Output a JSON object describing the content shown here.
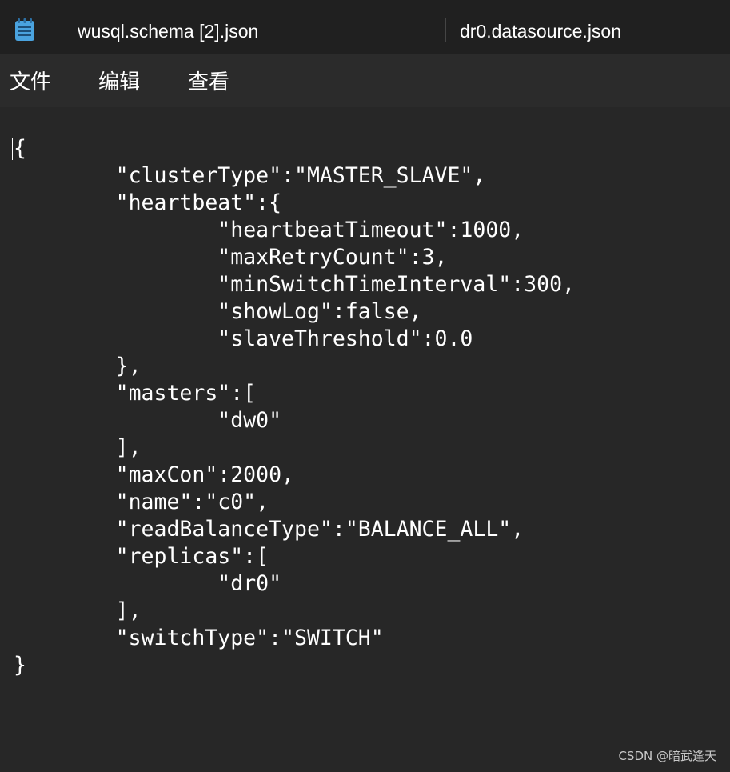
{
  "app": {
    "icon": "notepad-icon"
  },
  "tabs": [
    {
      "label": "wusql.schema [2].json"
    },
    {
      "label": "dr0.datasource.json"
    }
  ],
  "menu": {
    "file": "文件",
    "edit": "编辑",
    "view": "查看"
  },
  "editor": {
    "lines": [
      "{",
      "\t\"clusterType\":\"MASTER_SLAVE\",",
      "\t\"heartbeat\":{",
      "\t\t\"heartbeatTimeout\":1000,",
      "\t\t\"maxRetryCount\":3,",
      "\t\t\"minSwitchTimeInterval\":300,",
      "\t\t\"showLog\":false,",
      "\t\t\"slaveThreshold\":0.0",
      "\t},",
      "\t\"masters\":[",
      "\t\t\"dw0\"",
      "\t],",
      "\t\"maxCon\":2000,",
      "\t\"name\":\"c0\",",
      "\t\"readBalanceType\":\"BALANCE_ALL\",",
      "\t\"replicas\":[",
      "\t\t\"dr0\"",
      "\t],",
      "\t\"switchType\":\"SWITCH\"",
      "}"
    ]
  },
  "watermark": "CSDN @暗武逢天"
}
